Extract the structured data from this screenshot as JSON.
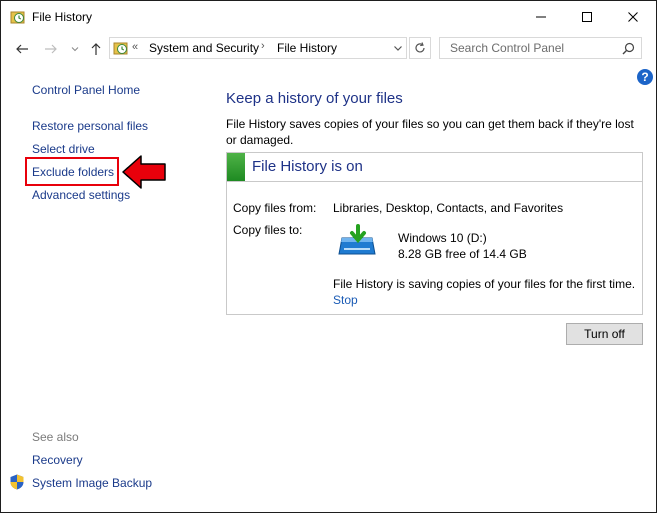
{
  "window": {
    "title": "File History"
  },
  "address": {
    "chevron": "«",
    "crumbs": [
      "System and Security",
      "File History"
    ],
    "separator": "›"
  },
  "search": {
    "placeholder": "Search Control Panel"
  },
  "sidebar": {
    "links": [
      "Control Panel Home",
      "Restore personal files",
      "Select drive",
      "Exclude folders",
      "Advanced settings"
    ],
    "see_also_label": "See also",
    "see_also": [
      "Recovery",
      "System Image Backup"
    ]
  },
  "main": {
    "heading": "Keep a history of your files",
    "description": "File History saves copies of your files so you can get them back if they're lost or damaged.",
    "status_title": "File History is on",
    "copy_from_label": "Copy files from:",
    "copy_from_value": "Libraries, Desktop, Contacts, and Favorites",
    "copy_to_label": "Copy files to:",
    "drive_name": "Windows 10 (D:)",
    "drive_free": "8.28 GB free of 14.4 GB",
    "saving_message": "File History is saving copies of your files for the first time.",
    "stop_label": "Stop",
    "turn_off_label": "Turn off"
  },
  "icons": {
    "app": "file-history-icon",
    "back": "back-arrow-icon",
    "forward": "forward-arrow-icon",
    "up": "up-arrow-icon",
    "refresh": "refresh-icon",
    "search": "search-icon",
    "help": "help-icon",
    "shield": "shield-icon",
    "drive": "drive-icon"
  },
  "colors": {
    "link": "#1a3a8a",
    "heading": "#1e3287",
    "highlight": "#e8000b",
    "status_green": "#2e9a2e",
    "help_blue": "#1c64c8"
  }
}
